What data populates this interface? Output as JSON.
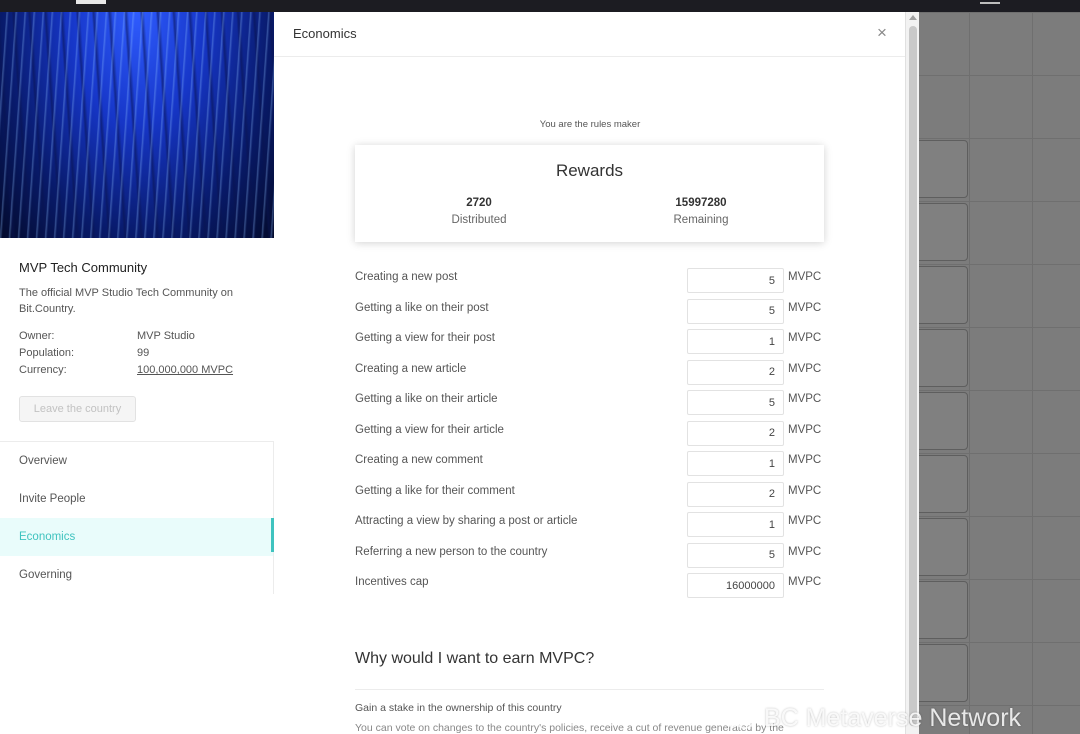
{
  "sidebar": {
    "country_name": "MVP Tech Community",
    "description": "The official MVP Studio Tech Community on Bit.Country.",
    "info": [
      {
        "key": "Owner:",
        "value": "MVP Studio"
      },
      {
        "key": "Population:",
        "value": "99"
      },
      {
        "key": "Currency:",
        "value": "100,000,000 MVPC"
      }
    ],
    "leave_button": "Leave the country",
    "menu": [
      {
        "label": "Overview",
        "active": false
      },
      {
        "label": "Invite People",
        "active": false
      },
      {
        "label": "Economics",
        "active": true
      },
      {
        "label": "Governing",
        "active": false
      }
    ]
  },
  "modal": {
    "title": "Economics",
    "close_icon": "close-icon",
    "rules_maker_text": "You are the rules maker",
    "rewards": {
      "title": "Rewards",
      "distributed_value": "2720",
      "distributed_label": "Distributed",
      "remaining_value": "15997280",
      "remaining_label": "Remaining"
    },
    "rates": [
      {
        "label": "Creating a new post",
        "value": "5",
        "unit": "MVPC"
      },
      {
        "label": "Getting a like on their post",
        "value": "5",
        "unit": "MVPC"
      },
      {
        "label": "Getting a view for their post",
        "value": "1",
        "unit": "MVPC"
      },
      {
        "label": "Creating a new article",
        "value": "2",
        "unit": "MVPC"
      },
      {
        "label": "Getting a like on their article",
        "value": "5",
        "unit": "MVPC"
      },
      {
        "label": "Getting a view for their article",
        "value": "2",
        "unit": "MVPC"
      },
      {
        "label": "Creating a new comment",
        "value": "1",
        "unit": "MVPC"
      },
      {
        "label": "Getting a like for their comment",
        "value": "2",
        "unit": "MVPC"
      },
      {
        "label": "Attracting a view by sharing a post or article",
        "value": "1",
        "unit": "MVPC"
      },
      {
        "label": "Referring a new person to the country",
        "value": "5",
        "unit": "MVPC"
      },
      {
        "label": "Incentives cap",
        "value": "16000000",
        "unit": "MVPC"
      }
    ],
    "why_title": "Why would I want to earn MVPC?",
    "stake_title": "Gain a stake in the ownership of this country",
    "stake_desc": "You can vote on changes to the country's policies, receive a cut of revenue generated by the"
  },
  "watermark": "BC Metaverse Network",
  "colors": {
    "accent": "#3fc3bf",
    "active_bg": "#e9fcfb",
    "overlay": "#7d7d7d"
  }
}
